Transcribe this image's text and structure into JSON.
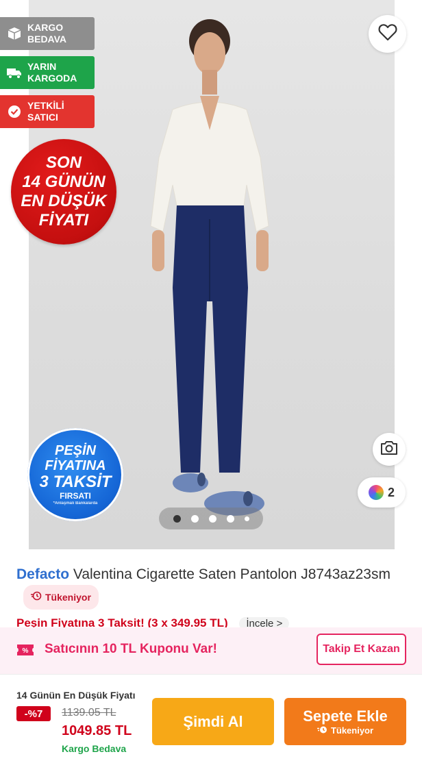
{
  "badges": {
    "kargo_bedava": "KARGO\nBEDAVA",
    "yarin_kargoda": "YARIN\nKARGODA",
    "yetkili_satici": "YETKİLİ\nSATICI"
  },
  "lowest_price_badge": {
    "line1": "SON",
    "line2": "14 GÜNÜN",
    "line3": "EN DÜŞÜK",
    "line4": "FİYATI"
  },
  "taksit_badge": {
    "line1": "PEŞİN",
    "line2": "FİYATINA",
    "line3": "3 TAKSİT",
    "line4": "FIRSATI",
    "note": "*Anlaşmalı Bankalarda"
  },
  "image": {
    "alt": "Defacto Valentina Cigarette Saten Pantolon",
    "slide_count": 5,
    "active_slide": 1
  },
  "color_count": "2",
  "product": {
    "brand": "Defacto",
    "name": "Valentina Cigarette Saten Pantolon J8743az23sm",
    "stock_status": "Tükeniyor",
    "installment_text": "Peşin Fiyatına 3 Taksit! (3 x 349.95 TL)",
    "incele": "İncele >"
  },
  "coupon": {
    "text": "Satıcının 10 TL Kuponu Var!",
    "button": "Takip Et Kazan"
  },
  "bottom": {
    "lowest_label": "14 Günün En Düşük Fiyatı",
    "discount": "-%7",
    "old_price": "1139.05 TL",
    "new_price": "1049.85 TL",
    "shipping": "Kargo Bedava",
    "buy_now": "Şimdi Al",
    "add_to_cart": "Sepete Ekle",
    "add_to_cart_sub": "Tükeniyor"
  },
  "colors": {
    "brand_blue": "#2f6fcf",
    "sale_red": "#d0021b",
    "coupon_pink": "#e5245f",
    "buy_now": "#f7a817",
    "add_to_cart": "#f27a1a",
    "green": "#1ea44a"
  },
  "icons": [
    "box-icon",
    "truck-icon",
    "verified-icon",
    "heart-icon",
    "camera-icon",
    "color-wheel-icon",
    "clock-icon",
    "coupon-icon"
  ]
}
